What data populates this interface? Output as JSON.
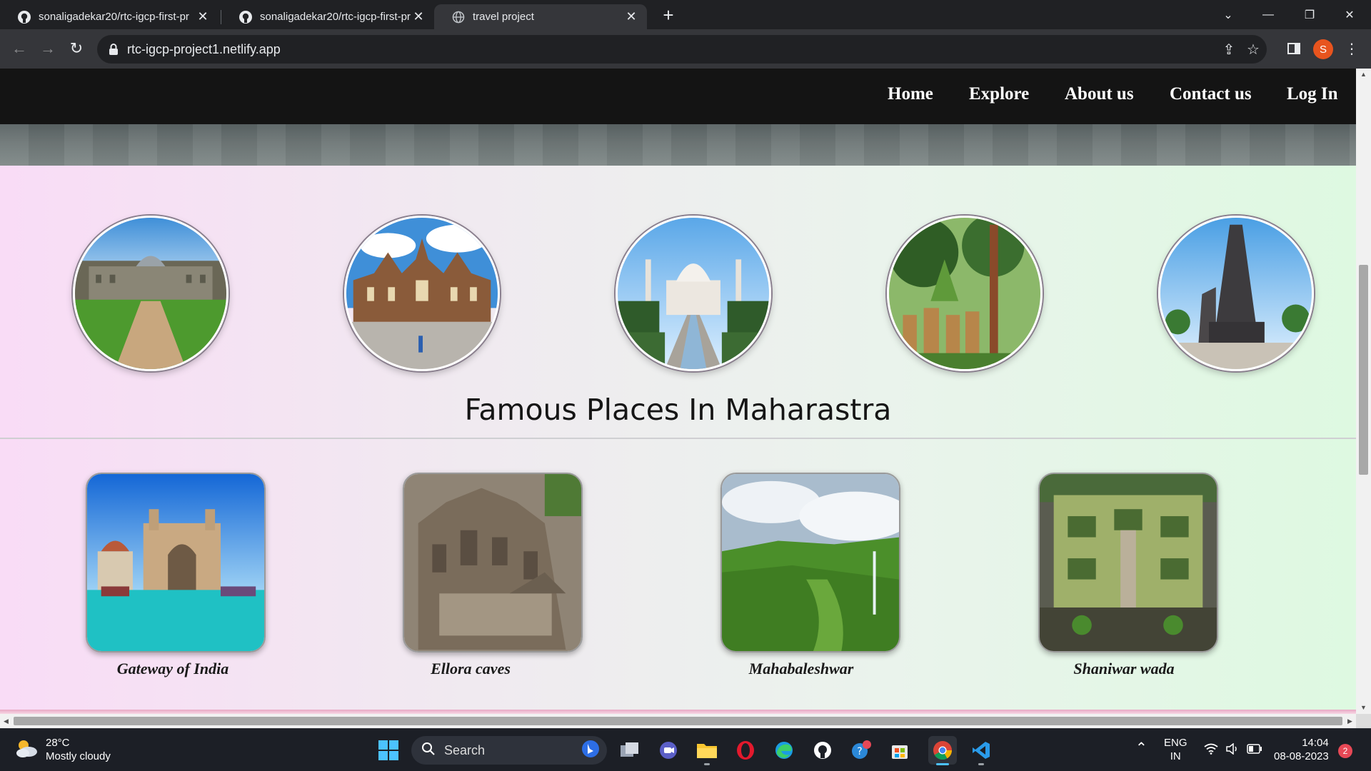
{
  "browser": {
    "tabs": [
      {
        "title": "sonaligadekar20/rtc-igcp-first-pr",
        "icon": "github-icon"
      },
      {
        "title": "sonaligadekar20/rtc-igcp-first-pr",
        "icon": "github-icon"
      },
      {
        "title": "travel project",
        "icon": "globe-icon"
      }
    ],
    "url": "rtc-igcp-project1.netlify.app",
    "profile_initial": "S"
  },
  "site": {
    "nav": [
      "Home",
      "Explore",
      "About us",
      "Contact us",
      "Log In"
    ],
    "section_title": "Famous Places In Maharastra",
    "places": [
      {
        "caption": "Gateway of India"
      },
      {
        "caption": "Ellora caves"
      },
      {
        "caption": "Mahabaleshwar"
      },
      {
        "caption": "Shaniwar wada"
      }
    ]
  },
  "taskbar": {
    "weather_temp": "28°C",
    "weather_desc": "Mostly cloudy",
    "search_label": "Search",
    "lang_top": "ENG",
    "lang_bottom": "IN",
    "time": "14:04",
    "date": "08-08-2023",
    "notification_count": "2"
  },
  "colors": {
    "nav_background": "#141414",
    "content_gradient_start": "#f9dcf6",
    "content_gradient_end": "#def9e1",
    "accent_taskbar": "#4cc2ff"
  }
}
